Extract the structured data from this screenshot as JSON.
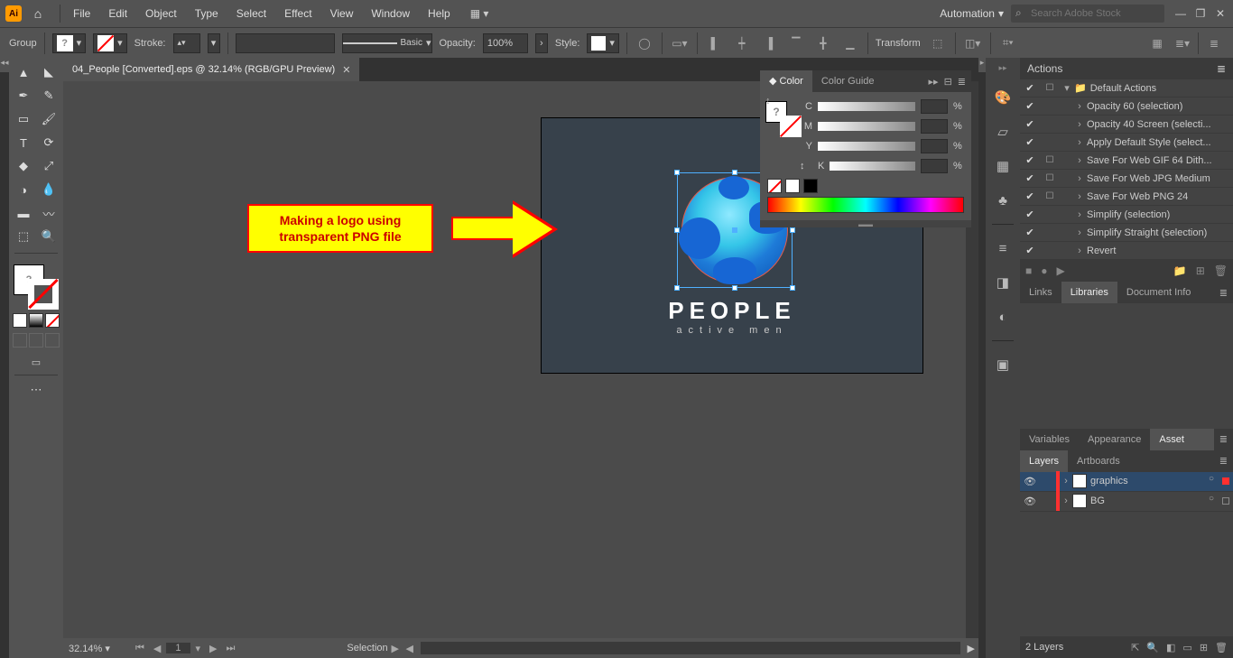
{
  "menubar": {
    "items": [
      "File",
      "Edit",
      "Object",
      "Type",
      "Select",
      "Effect",
      "View",
      "Window",
      "Help"
    ],
    "workspace": "Automation",
    "stock_placeholder": "Search Adobe Stock"
  },
  "controlbar": {
    "selection_type": "Group",
    "stroke_label": "Stroke:",
    "brush_label": "Basic",
    "opacity_label": "Opacity:",
    "opacity_value": "100%",
    "style_label": "Style:",
    "transform_label": "Transform"
  },
  "doc": {
    "tab_title": "04_People [Converted].eps @ 32.14% (RGB/GPU Preview)",
    "zoom": "32.14%",
    "artboard_num": "1",
    "status_selection": "Selection"
  },
  "canvas": {
    "logo_title": "PEOPLE",
    "logo_sub": "active men",
    "callout_line1": "Making a logo using",
    "callout_line2": "transparent PNG file"
  },
  "color_panel": {
    "tab_color": "Color",
    "tab_guide": "Color Guide",
    "channels": [
      "C",
      "M",
      "Y",
      "K"
    ],
    "pct": "%"
  },
  "actions": {
    "title": "Actions",
    "set": "Default Actions",
    "items": [
      {
        "label": "Opacity 60 (selection)",
        "box": false
      },
      {
        "label": "Opacity 40 Screen (selecti...",
        "box": false
      },
      {
        "label": "Apply Default Style (select...",
        "box": false
      },
      {
        "label": "Save For Web GIF 64 Dith...",
        "box": true
      },
      {
        "label": "Save For Web JPG Medium",
        "box": true
      },
      {
        "label": "Save For Web PNG 24",
        "box": true
      },
      {
        "label": "Simplify (selection)",
        "box": false
      },
      {
        "label": "Simplify Straight (selection)",
        "box": false
      },
      {
        "label": "Revert",
        "box": false
      }
    ]
  },
  "tabs_mid": {
    "links": "Links",
    "libraries": "Libraries",
    "docinfo": "Document Info"
  },
  "tabs_var": {
    "variables": "Variables",
    "appearance": "Appearance",
    "asset": "Asset Export"
  },
  "layers": {
    "tab_layers": "Layers",
    "tab_artboards": "Artboards",
    "rows": [
      {
        "name": "graphics",
        "color": "#ff3030",
        "selected": true
      },
      {
        "name": "BG",
        "color": "#ff3030",
        "selected": false
      }
    ],
    "footer_count": "2 Layers"
  }
}
